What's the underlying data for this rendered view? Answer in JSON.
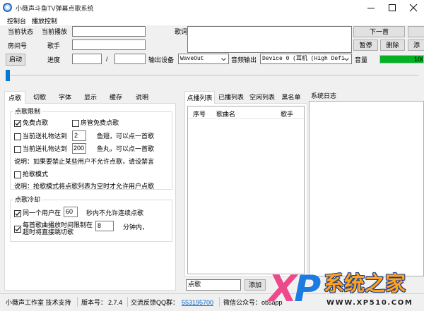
{
  "window": {
    "title": "小薇声斗鱼TV弹幕点歌系统"
  },
  "menu": {
    "items": [
      "控制台",
      "播放控制"
    ]
  },
  "controls": {
    "status_label": "当前状态",
    "now_playing_label": "当前播放",
    "room_label": "房间号",
    "singer_label": "歌手",
    "lyrics_label": "歌词",
    "next_button": "下一首",
    "pause_button": "暂停",
    "delete_button": "删除",
    "add_button_partial": "添",
    "start_button": "启动",
    "progress_label": "进度",
    "progress_separator": "/",
    "output_device_label": "输出设备",
    "output_device_value": "WaveOut",
    "audio_output_label": "音频输出",
    "audio_output_value": "Device 0 (耳机 (High Defi",
    "volume_label": "音量",
    "volume_value": "100",
    "volume_level": 1.0
  },
  "seek": {
    "position": 0.0
  },
  "left_tabs": {
    "active": 0,
    "items": [
      "点歌",
      "切歌",
      "字体",
      "显示",
      "缓存",
      "说明"
    ]
  },
  "request_limit": {
    "title": "点歌限制",
    "free_request": {
      "label": "免费点歌",
      "checked": true
    },
    "admin_free": {
      "label": "房管免费点歌",
      "checked": false
    },
    "gift_fin": {
      "label": "当前送礼物达到",
      "value": "2",
      "suffix": "鱼翅，可以点一首歌",
      "checked": false
    },
    "gift_ball": {
      "label": "当前送礼物达到",
      "value": "200",
      "suffix": "鱼丸，可以点一首歌",
      "checked": false
    },
    "note_ban": "说明：如果要禁止某些用户不允许点歌，请设禁言",
    "grab_mode": {
      "label": "抢歌模式",
      "checked": false
    },
    "note_grab": "说明：抢歌模式将点歌列表为空时才允许用户点歌"
  },
  "request_cooldown": {
    "title": "点歌冷却",
    "same_user": {
      "label": "同一个用户在",
      "value": "60",
      "suffix": "秒内不允许连续点歌",
      "checked": true
    },
    "time_limit": {
      "label_line1": "每首歌曲播放时间限制在",
      "label_line2": "超时将直接跳切歌",
      "value": "8",
      "suffix": "分钟内，",
      "checked": true
    }
  },
  "playlist_tabs": {
    "active": 0,
    "items": [
      "点播列表",
      "已播列表",
      "空闲列表",
      "黑名单"
    ]
  },
  "playlist": {
    "columns": [
      "序号",
      "歌曲名",
      "歌手"
    ],
    "request_input_value": "点歌",
    "add_button": "添加"
  },
  "log": {
    "title": "系统日志"
  },
  "status_bar": {
    "studio": "小薇声工作室 技术支持",
    "version_label": "版本号：",
    "version": "2.7.4",
    "qq_label": "交流反馈QQ群：",
    "qq_group": "553195700",
    "wechat": "微信公众号：obsapp"
  },
  "watermark": {
    "logo": "XP",
    "brand": "系统之家",
    "url": "WWW.XP510.COM"
  },
  "colors": {
    "accent": "#0078d7",
    "volume_fill": "#06b025",
    "link": "#0066cc"
  }
}
